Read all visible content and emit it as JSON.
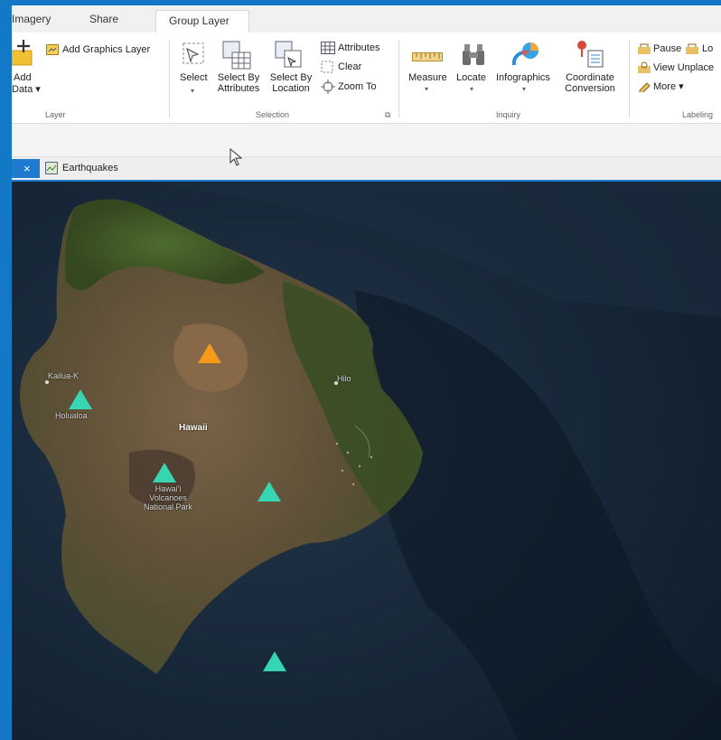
{
  "ribbon_tabs": {
    "imagery": "Imagery",
    "share": "Share",
    "group_layer": "Group Layer"
  },
  "layer_group": {
    "add_data": "Add",
    "add_data_line2": "Data",
    "add_graphics_layer": "Add Graphics Layer",
    "label": "Layer"
  },
  "selection_group": {
    "select": "Select",
    "select_by_attributes_1": "Select By",
    "select_by_attributes_2": "Attributes",
    "select_by_location_1": "Select By",
    "select_by_location_2": "Location",
    "attributes": "Attributes",
    "clear": "Clear",
    "zoom_to": "Zoom To",
    "label": "Selection"
  },
  "inquiry_group": {
    "measure": "Measure",
    "locate": "Locate",
    "infographics": "Infographics",
    "coordinate_1": "Coordinate",
    "coordinate_2": "Conversion",
    "label": "Inquiry"
  },
  "labeling_group": {
    "pause": "Pause",
    "lock": "Lo",
    "view_unplaced": "View Unplace",
    "more": "More",
    "label": "Labeling"
  },
  "view_tab": {
    "close": "×",
    "title": "Earthquakes"
  },
  "map_labels": {
    "kailua": "Kailua-K",
    "holualoa": "Holualoa",
    "hawaii": "Hawaii",
    "hilo": "Hilo",
    "park_1": "Hawai'i",
    "park_2": "Volcanoes",
    "park_3": "National Park"
  },
  "colors": {
    "accent": "#1f7bd0",
    "earthquake_teal": "#35d6b1",
    "earthquake_orange": "#f59a1b"
  }
}
